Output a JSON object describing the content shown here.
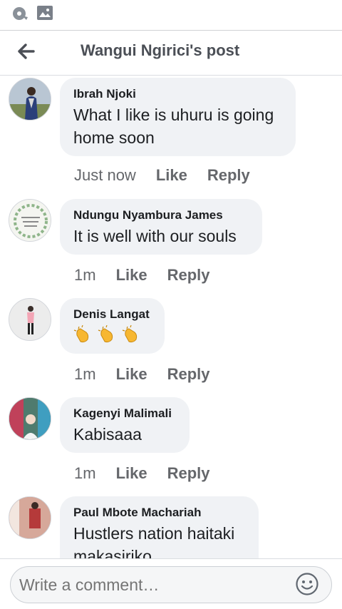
{
  "status_bar": {
    "icons": [
      "sync-icon",
      "image-icon"
    ]
  },
  "header": {
    "title": "Wangui Ngirici's post",
    "back_icon": "arrow-left-icon"
  },
  "comments": [
    {
      "author": "Ibrah Njoki",
      "text_lines": [
        "What I like is uhuru is going",
        "home soon"
      ],
      "time": "Just now",
      "like": "Like",
      "reply": "Reply"
    },
    {
      "author": "Ndungu Nyambura James",
      "text_lines": [
        "It is well with our souls"
      ],
      "time": "1m",
      "like": "Like",
      "reply": "Reply"
    },
    {
      "author": "Denis Langat",
      "emoji": "clapping-hands",
      "emoji_count": 3,
      "time": "1m",
      "like": "Like",
      "reply": "Reply"
    },
    {
      "author": "Kagenyi Malimali",
      "text_lines": [
        "Kabisaaa"
      ],
      "time": "1m",
      "like": "Like",
      "reply": "Reply"
    },
    {
      "author": "Paul Mbote Machariah",
      "text_lines": [
        "Hustlers nation haitaki",
        "makasiriko"
      ]
    }
  ],
  "composer": {
    "placeholder": "Write a comment…",
    "emoji_icon": "smiley-icon"
  },
  "colors": {
    "bubble": "#f0f2f5",
    "meta_text": "#65676b",
    "header_text": "#4b4f56"
  }
}
